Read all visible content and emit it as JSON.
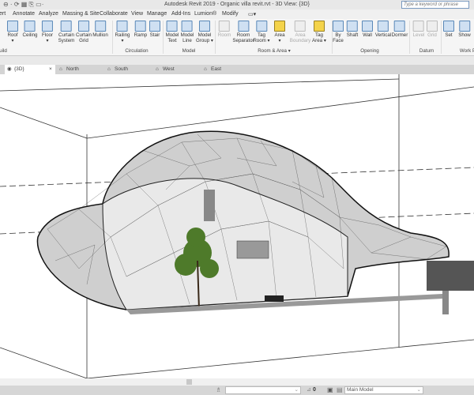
{
  "window": {
    "title": "Autodesk Revit 2019 - Organic villa revit.rvt - 3D View: {3D}",
    "search_placeholder": "Type a keyword or phrase"
  },
  "menu": [
    "ert",
    "Annotate",
    "Analyze",
    "Massing & Site",
    "Collaborate",
    "View",
    "Manage",
    "Add-Ins",
    "Lumion®",
    "Modify"
  ],
  "ribbon": {
    "tools": [
      {
        "label": "Roof",
        "sub": "▾",
        "state": "normal"
      },
      {
        "label": "Ceiling",
        "sub": "",
        "state": "normal"
      },
      {
        "label": "Floor",
        "sub": "▾",
        "state": "normal"
      },
      {
        "label": "Curtain",
        "sub": "System",
        "state": "normal"
      },
      {
        "label": "Curtain",
        "sub": "Grid",
        "state": "normal"
      },
      {
        "label": "Mullion",
        "sub": "",
        "state": "normal"
      },
      {
        "label": "Railing",
        "sub": "▾",
        "state": "normal"
      },
      {
        "label": "Ramp",
        "sub": "",
        "state": "normal"
      },
      {
        "label": "Stair",
        "sub": "",
        "state": "normal"
      },
      {
        "label": "Model",
        "sub": "Text",
        "state": "normal"
      },
      {
        "label": "Model",
        "sub": "Line",
        "state": "normal"
      },
      {
        "label": "Model",
        "sub": "Group ▾",
        "state": "normal"
      },
      {
        "label": "Room",
        "sub": "",
        "state": "disabled"
      },
      {
        "label": "Room",
        "sub": "Separator",
        "state": "normal"
      },
      {
        "label": "Tag",
        "sub": "Room ▾",
        "state": "normal"
      },
      {
        "label": "Area",
        "sub": "▾",
        "state": "yellow"
      },
      {
        "label": "Area",
        "sub": "Boundary",
        "state": "disabled"
      },
      {
        "label": "Tag",
        "sub": "Area ▾",
        "state": "yellow"
      },
      {
        "label": "By",
        "sub": "Face",
        "state": "normal"
      },
      {
        "label": "Shaft",
        "sub": "",
        "state": "normal"
      },
      {
        "label": "Wall",
        "sub": "",
        "state": "normal"
      },
      {
        "label": "Vertical",
        "sub": "",
        "state": "normal"
      },
      {
        "label": "Dormer",
        "sub": "",
        "state": "normal"
      },
      {
        "label": "Level",
        "sub": "",
        "state": "disabled"
      },
      {
        "label": "Grid",
        "sub": "",
        "state": "disabled"
      },
      {
        "label": "Set",
        "sub": "",
        "state": "normal"
      },
      {
        "label": "Show",
        "sub": "",
        "state": "normal"
      }
    ],
    "groups": [
      "uild",
      "Circulation",
      "Model",
      "Room & Area ▾",
      "Opening",
      "Datum",
      "Work P"
    ]
  },
  "view_tabs": [
    {
      "label": "{3D}",
      "close": "×"
    },
    {
      "label": "North"
    },
    {
      "label": "South"
    },
    {
      "label": "West"
    },
    {
      "label": "East"
    }
  ],
  "status": {
    "filter_value": "0",
    "model_combo": "Main Model"
  }
}
